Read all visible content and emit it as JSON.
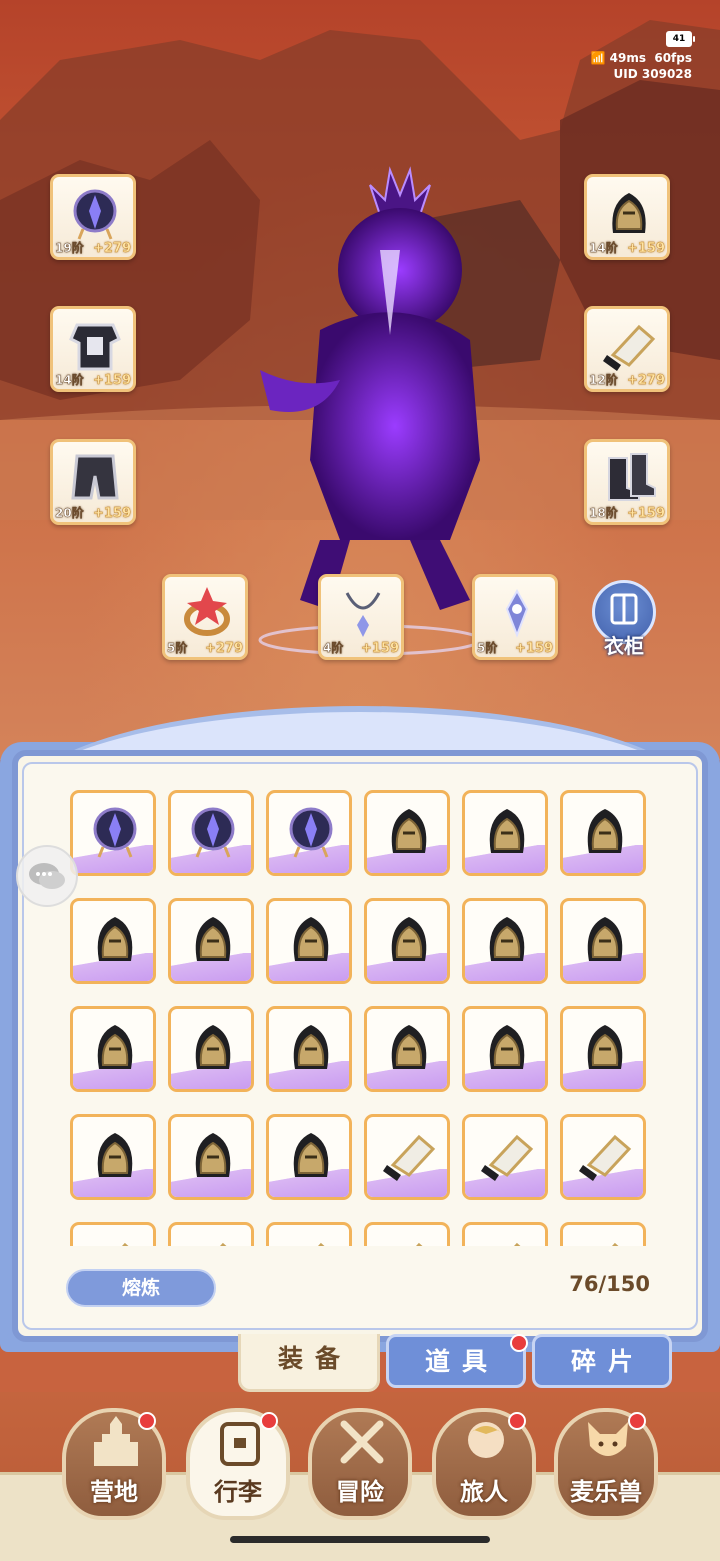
{
  "status": {
    "battery": "41",
    "ping": "49ms",
    "fps": "60fps",
    "uid": "UID 309028"
  },
  "equipped": {
    "helmet_left": {
      "tier": "19阶",
      "bonus": "+279"
    },
    "armor_left": {
      "tier": "14阶",
      "bonus": "+159"
    },
    "pants_left": {
      "tier": "20阶",
      "bonus": "+159"
    },
    "helmet_right": {
      "tier": "14阶",
      "bonus": "+159"
    },
    "gauntlet_right": {
      "tier": "12阶",
      "bonus": "+279"
    },
    "boots_right": {
      "tier": "18阶",
      "bonus": "+159"
    },
    "ring": {
      "tier": "5阶",
      "bonus": "+279"
    },
    "necklace": {
      "tier": "4阶",
      "bonus": "+159"
    },
    "amulet": {
      "tier": "5阶",
      "bonus": "+159"
    }
  },
  "wardrobe": {
    "label": "衣柜"
  },
  "inventory": {
    "items": [
      "orb-helmet",
      "orb-helmet",
      "orb-helmet",
      "knight-helmet",
      "knight-helmet",
      "knight-helmet",
      "knight-helmet",
      "knight-helmet",
      "knight-helmet",
      "knight-helmet",
      "knight-helmet",
      "knight-helmet",
      "knight-helmet",
      "knight-helmet",
      "knight-helmet",
      "knight-helmet",
      "knight-helmet",
      "knight-helmet",
      "knight-helmet",
      "knight-helmet",
      "knight-helmet",
      "gauntlet",
      "gauntlet",
      "gauntlet",
      "gauntlet",
      "gauntlet",
      "gauntlet",
      "gauntlet",
      "gauntlet",
      "gauntlet"
    ],
    "smelt_label": "熔炼",
    "capacity": "76/150"
  },
  "subtabs": {
    "equipment": "装备",
    "items": "道具",
    "fragments": "碎片"
  },
  "nav": {
    "camp": "营地",
    "luggage": "行李",
    "adventure": "冒险",
    "traveler": "旅人",
    "beast": "麦乐兽"
  },
  "colors": {
    "accent_blue": "#7f98d4",
    "slot_border": "#f0c27a",
    "rarity_purple": "#c99cf0",
    "red_dot": "#e83d3d"
  }
}
